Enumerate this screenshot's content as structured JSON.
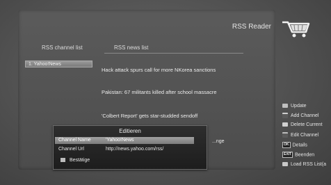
{
  "header": {
    "title": "RSS Reader"
  },
  "channel_list": {
    "header": "RSS channel list",
    "items": [
      {
        "label": "1. Yahoo!News"
      }
    ]
  },
  "news_list": {
    "header": "RSS news list",
    "items": [
      {
        "text": "Hack attack spurs call for more NKorea sanctions"
      },
      {
        "text": "Pakistan: 67 militants killed after school massacre"
      },
      {
        "text": "'Colbert Report' gets star-studded sendoff"
      },
      {
        "text": "...nge"
      }
    ]
  },
  "legend": [
    {
      "label": "Update",
      "color": "#c0c0c0"
    },
    {
      "label": "Add Channel",
      "color": "#d8d8d8"
    },
    {
      "label": "Delete Current",
      "color": "#d0d0d0"
    },
    {
      "label": "Edit Channel",
      "color": "#bdbdbd"
    },
    {
      "label": "Details",
      "key": "OK"
    },
    {
      "label": "Beenden",
      "key": "EXIT"
    },
    {
      "label": "Load RSS List(a",
      "color": "#c8c8c8"
    }
  ],
  "dialog": {
    "title": "Editieren",
    "fields": [
      {
        "label": "Channel Name",
        "value": "'Yahoo!News"
      },
      {
        "label": "Channel Url",
        "value": "http://news.yahoo.com/rss/"
      }
    ],
    "confirm_label": "Bestätige"
  }
}
